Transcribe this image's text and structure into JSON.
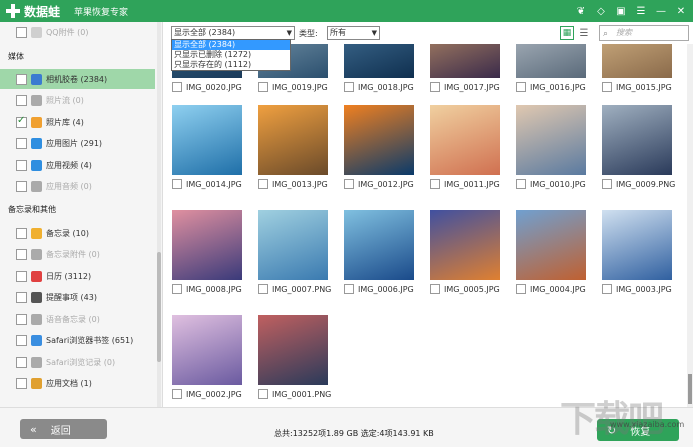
{
  "titlebar": {
    "app_name": "数据蛙",
    "subtitle": "苹果恢复专家",
    "icons": [
      "gift-icon",
      "diamond-icon",
      "chat-icon",
      "menu-icon",
      "minimize-icon",
      "close-icon"
    ]
  },
  "sidebar": {
    "top_partial": {
      "label": "QQ附件 (0)",
      "disabled": true
    },
    "media_heading": "媒体",
    "media": [
      {
        "label": "相机胶卷 (2384)",
        "checked": false,
        "disabled": false,
        "active": true,
        "icon": "camera-icon",
        "color": "#3b7bd1"
      },
      {
        "label": "照片流 (0)",
        "checked": false,
        "disabled": true,
        "icon": "photo-stream-icon",
        "color": "#aaaaaa"
      },
      {
        "label": "照片库 (4)",
        "checked": true,
        "disabled": false,
        "icon": "photos-icon",
        "color": "#f0a030"
      },
      {
        "label": "应用图片 (291)",
        "checked": false,
        "disabled": false,
        "icon": "app-image-icon",
        "color": "#2f8ee0"
      },
      {
        "label": "应用视频 (4)",
        "checked": false,
        "disabled": false,
        "icon": "app-video-icon",
        "color": "#2f8ee0"
      },
      {
        "label": "应用音频 (0)",
        "checked": false,
        "disabled": true,
        "icon": "app-audio-icon",
        "color": "#aaaaaa"
      }
    ],
    "memo_heading": "备忘录和其他",
    "memo": [
      {
        "label": "备忘录 (10)",
        "checked": false,
        "disabled": false,
        "icon": "notes-icon",
        "color": "#f0b030"
      },
      {
        "label": "备忘录附件 (0)",
        "checked": false,
        "disabled": true,
        "icon": "notes-attachment-icon",
        "color": "#aaaaaa"
      },
      {
        "label": "日历 (3112)",
        "checked": false,
        "disabled": false,
        "icon": "calendar-icon",
        "color": "#e04040"
      },
      {
        "label": "提醒事项 (43)",
        "checked": false,
        "disabled": false,
        "icon": "reminders-icon",
        "color": "#555555"
      },
      {
        "label": "语音备忘录 (0)",
        "checked": false,
        "disabled": true,
        "icon": "voice-memo-icon",
        "color": "#aaaaaa"
      },
      {
        "label": "Safari浏览器书签 (651)",
        "checked": false,
        "disabled": false,
        "icon": "safari-bookmark-icon",
        "color": "#3a8ee0"
      },
      {
        "label": "Safari浏览记录 (0)",
        "checked": false,
        "disabled": true,
        "icon": "safari-history-icon",
        "color": "#aaaaaa"
      },
      {
        "label": "应用文档 (1)",
        "checked": false,
        "disabled": false,
        "icon": "app-document-icon",
        "color": "#e0a030"
      }
    ]
  },
  "toolbar": {
    "filter_selected": "显示全部 (2384)",
    "filter_options": [
      "显示全部 (2384)",
      "只显示已删除 (1272)",
      "只显示存在的 (1112)"
    ],
    "type_label": "类型:",
    "type_selected": "所有",
    "search_placeholder": "搜索"
  },
  "gallery": {
    "rows": [
      [
        "IMG_0020.JPG",
        "IMG_0019.JPG",
        "IMG_0018.JPG",
        "IMG_0017.JPG",
        "IMG_0016.JPG",
        "IMG_0015.JPG"
      ],
      [
        "IMG_0014.JPG",
        "IMG_0013.JPG",
        "IMG_0012.JPG",
        "IMG_0011.JPG",
        "IMG_0010.JPG",
        "IMG_0009.PNG"
      ],
      [
        "IMG_0008.JPG",
        "IMG_0007.PNG",
        "IMG_0006.JPG",
        "IMG_0005.JPG",
        "IMG_0004.JPG",
        "IMG_0003.JPG"
      ],
      [
        "IMG_0002.JPG",
        "IMG_0001.PNG"
      ]
    ]
  },
  "bottombar": {
    "back_label": "返回",
    "status": "总共:13252项1.89 GB 选定:4项143.91 KB",
    "recover_label": "恢复"
  },
  "watermark": {
    "text": "下载吧",
    "site": "www.xiazaiba.com"
  }
}
